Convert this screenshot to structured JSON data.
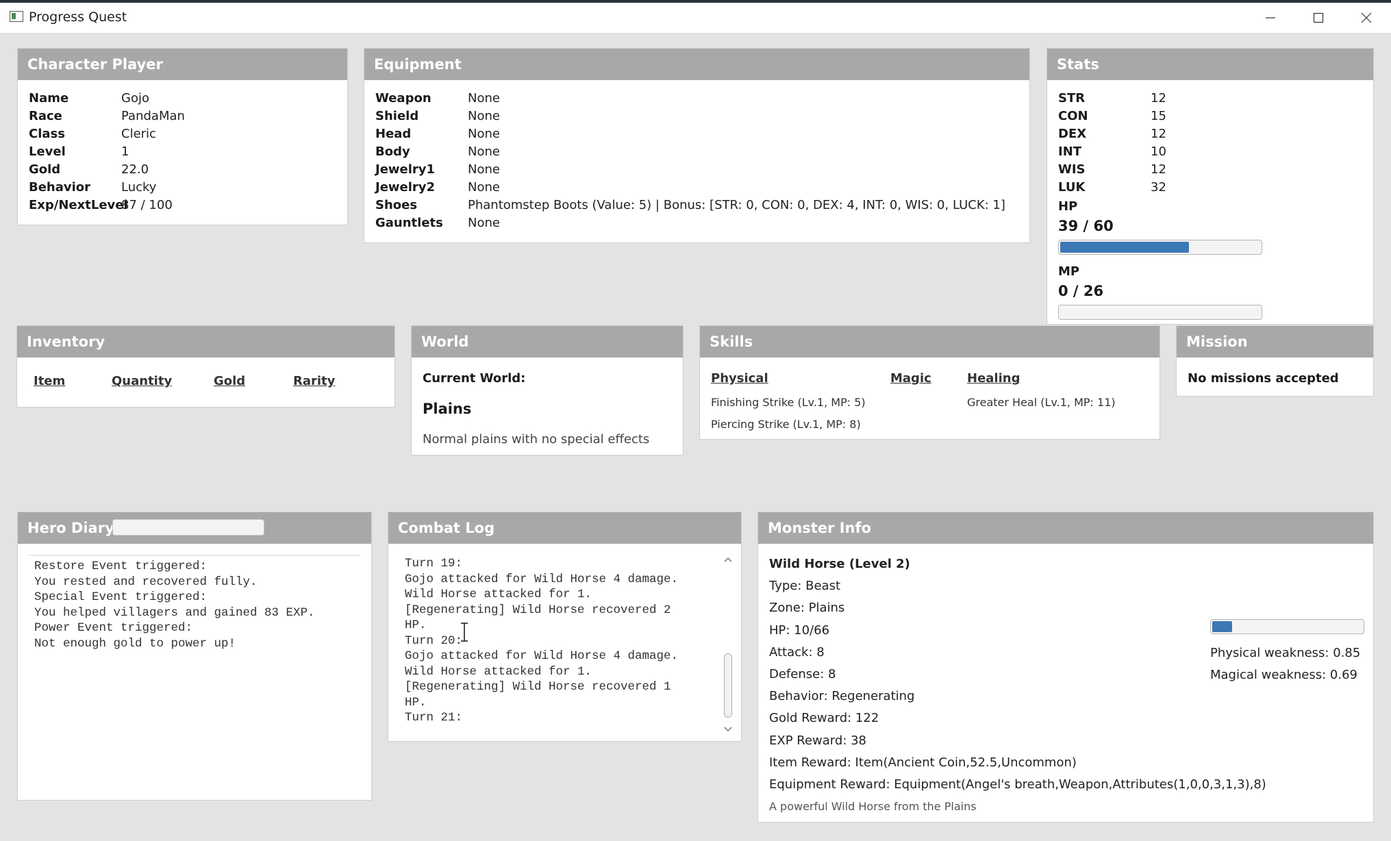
{
  "window": {
    "title": "Progress Quest",
    "controls": {
      "minimize_icon": "minimize-icon",
      "maximize_icon": "maximize-icon",
      "close_icon": "close-icon"
    }
  },
  "character": {
    "header": "Character Player",
    "rows": [
      {
        "label": "Name",
        "value": "Gojo"
      },
      {
        "label": "Race",
        "value": "PandaMan"
      },
      {
        "label": "Class",
        "value": "Cleric"
      },
      {
        "label": "Level",
        "value": "1"
      },
      {
        "label": "Gold",
        "value": "22.0"
      },
      {
        "label": "Behavior",
        "value": "Lucky"
      },
      {
        "label": "Exp/NextLevel",
        "value": "87 / 100"
      }
    ]
  },
  "equipment": {
    "header": "Equipment",
    "rows": [
      {
        "label": "Weapon",
        "value": "None"
      },
      {
        "label": "Shield",
        "value": "None"
      },
      {
        "label": "Head",
        "value": "None"
      },
      {
        "label": "Body",
        "value": "None"
      },
      {
        "label": "Jewelry1",
        "value": "None"
      },
      {
        "label": "Jewelry2",
        "value": "None"
      },
      {
        "label": "Shoes",
        "value": "Phantomstep Boots (Value: 5) | Bonus: [STR: 0, CON: 0, DEX: 4, INT: 0, WIS: 0, LUCK: 1]"
      },
      {
        "label": "Gauntlets",
        "value": "None"
      }
    ]
  },
  "stats": {
    "header": "Stats",
    "rows": [
      {
        "label": "STR",
        "value": "12"
      },
      {
        "label": "CON",
        "value": "15"
      },
      {
        "label": "DEX",
        "value": "12"
      },
      {
        "label": "INT",
        "value": "10"
      },
      {
        "label": "WIS",
        "value": "12"
      },
      {
        "label": "LUK",
        "value": "32"
      }
    ],
    "hp_label": "HP",
    "hp_value": "39 / 60",
    "hp_fraction": 0.65,
    "mp_label": "MP",
    "mp_value": "0 / 26",
    "mp_fraction": 0
  },
  "inventory": {
    "header": "Inventory",
    "columns": [
      "Item",
      "Quantity",
      "Gold",
      "Rarity"
    ]
  },
  "world": {
    "header": "World",
    "current_label": "Current World:",
    "name": "Plains",
    "description": "Normal plains with no special effects"
  },
  "skills": {
    "header": "Skills",
    "columns": [
      {
        "name": "Physical",
        "items": [
          "Finishing Strike (Lv.1, MP: 5)",
          "Piercing Strike (Lv.1, MP: 8)"
        ]
      },
      {
        "name": "Magic",
        "items": []
      },
      {
        "name": "Healing",
        "items": [
          "Greater Heal (Lv.1, MP: 11)"
        ]
      }
    ]
  },
  "mission": {
    "header": "Mission",
    "text": "No missions accepted"
  },
  "diary": {
    "header": "Hero Diary",
    "progress_fraction": 0,
    "lines": [
      "Restore Event triggered:",
      "You rested and recovered fully.",
      "Special Event triggered:",
      "You helped villagers and gained 83 EXP.",
      "Power Event triggered:",
      "Not enough gold to power up!"
    ]
  },
  "combat_log": {
    "header": "Combat Log",
    "lines": [
      "Turn 19:",
      "Gojo attacked for Wild Horse 4 damage.",
      "Wild Horse attacked for 1.",
      "[Regenerating] Wild Horse recovered 2",
      "HP.",
      "Turn 20:",
      "Gojo attacked for Wild Horse 4 damage.",
      "Wild Horse attacked for 1.",
      "[Regenerating] Wild Horse recovered 1",
      "HP.",
      "Turn 21:"
    ]
  },
  "monster": {
    "header": "Monster Info",
    "name": "Wild Horse (Level 2)",
    "type": "Type: Beast",
    "zone": "Zone: Plains",
    "hp": "HP: 10/66",
    "hp_fraction": 0.15,
    "attack": "Attack: 8",
    "defense": "Defense: 8",
    "behavior": "Behavior: Regenerating",
    "gold_reward": "Gold Reward: 122",
    "exp_reward": "EXP Reward: 38",
    "item_reward": "Item Reward: Item(Ancient Coin,52.5,Uncommon)",
    "equipment_reward": "Equipment Reward: Equipment(Angel's breath,Weapon,Attributes(1,0,0,3,1,3),8)",
    "description": "A powerful Wild Horse from the Plains",
    "physical_weakness": "Physical weakness: 0.85",
    "magical_weakness": "Magical weakness: 0.69"
  }
}
